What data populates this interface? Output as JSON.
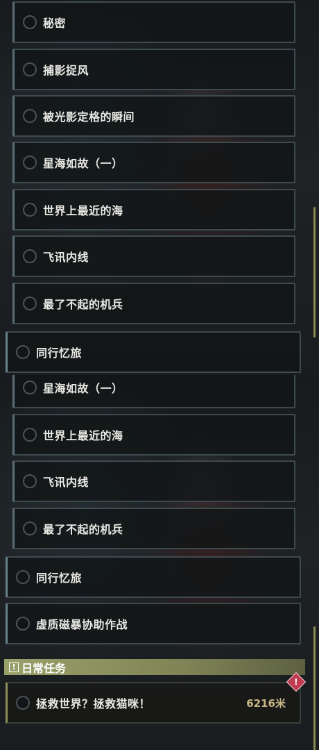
{
  "top_panel": {
    "quests": [
      {
        "label": "秘密"
      },
      {
        "label": "捕影捉风"
      },
      {
        "label": "被光影定格的瞬间"
      },
      {
        "label": "星海如故（一）"
      },
      {
        "label": "世界上最近的海"
      },
      {
        "label": "飞讯内线"
      },
      {
        "label": "最了不起的机兵"
      },
      {
        "label": "同行忆旅"
      }
    ]
  },
  "bottom_panel": {
    "quests": [
      {
        "label": "星海如故（一）"
      },
      {
        "label": "世界上最近的海"
      },
      {
        "label": "飞讯内线"
      },
      {
        "label": "最了不起的机兵"
      },
      {
        "label": "同行忆旅"
      },
      {
        "label": "虚质磁暴协助作战"
      }
    ],
    "daily_section": {
      "icon": "exclamation-box-icon",
      "title": "日常任务",
      "quest": {
        "label": "拯救世界？拯救猫咪！",
        "distance": "6216米",
        "badge_icon": "urgent-diamond-icon"
      }
    }
  },
  "colors": {
    "daily_accent": "#9aa06a",
    "urgent": "#c03c52",
    "distance_text": "#c8b686"
  }
}
